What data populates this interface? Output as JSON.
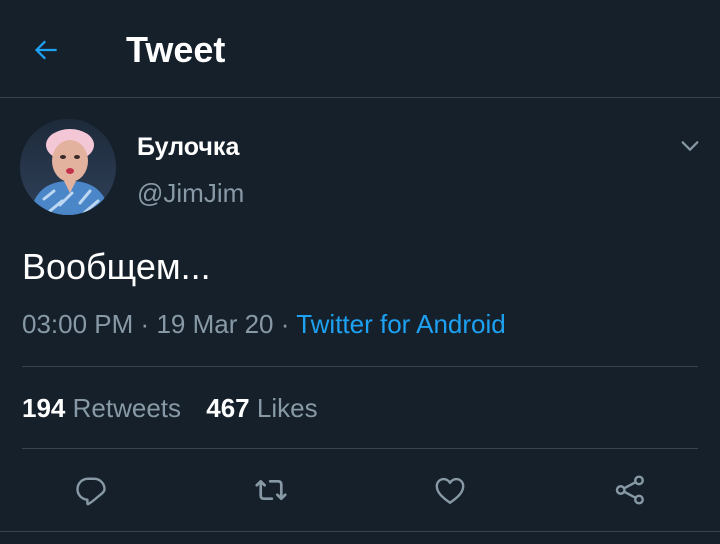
{
  "header": {
    "title": "Tweet",
    "back_icon": "arrow-left-icon"
  },
  "author": {
    "display_name": "Булочка",
    "handle": "@JimJim",
    "more_icon": "chevron-down-icon"
  },
  "tweet": {
    "text": "Вообщем...",
    "time": "03:00 PM",
    "date": "19 Mar 20",
    "separator": "·",
    "source": "Twitter for Android"
  },
  "stats": {
    "retweets_count": "194",
    "retweets_label": "Retweets",
    "likes_count": "467",
    "likes_label": "Likes"
  },
  "actions": [
    "reply-icon",
    "retweet-icon",
    "like-icon",
    "share-icon"
  ],
  "colors": {
    "background": "#15202B",
    "accent": "#1DA1F2",
    "secondary_text": "#8899A6",
    "divider": "#38444D"
  }
}
